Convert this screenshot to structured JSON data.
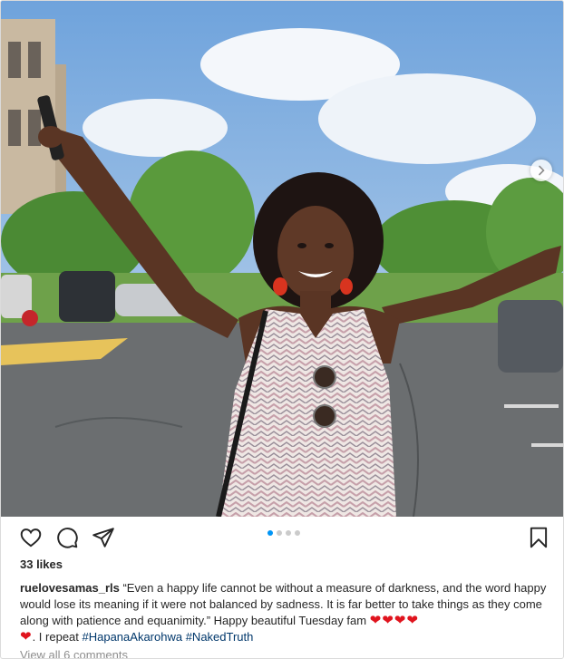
{
  "post": {
    "media_alt": "photo",
    "carousel": {
      "total": 4,
      "active": 0
    }
  },
  "actions": {
    "like_icon": "heart-outline-icon",
    "comment_icon": "comment-bubble-icon",
    "share_icon": "paper-plane-icon",
    "save_icon": "bookmark-icon"
  },
  "likes": {
    "text": "33 likes"
  },
  "caption": {
    "username": "ruelovesamas_rls",
    "text": " “Even a happy life cannot be without a measure of darkness, and the word happy would lose its meaning if it were not balanced by sadness. It is far better to take things as they come along with patience and equanimity.” Happy beautiful Tuesday fam ",
    "hearts_a": "❤❤❤❤",
    "hearts_b": "❤",
    "after_hearts": ". I repeat ",
    "hashtag_1": "#HapanaAkarohwa",
    "hashtag_2": "#NakedTruth"
  },
  "comments": {
    "text": "View all 6 comments"
  },
  "colors": {
    "accent": "#0095f6",
    "heart": "#e0141e",
    "hashtag": "#00376b"
  }
}
